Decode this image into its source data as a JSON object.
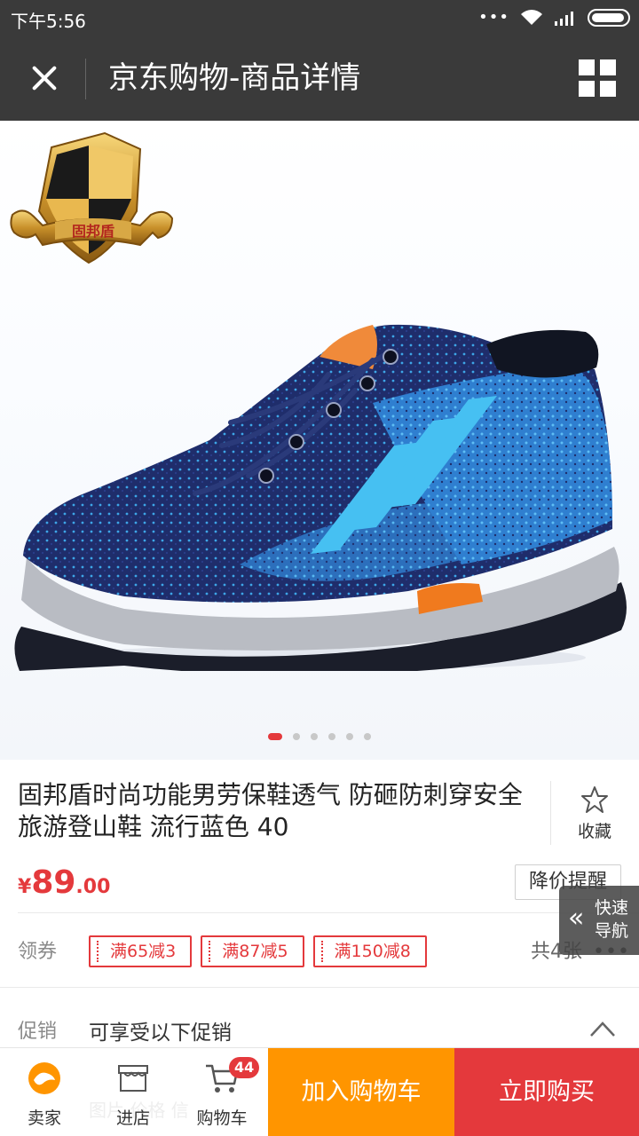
{
  "status_bar": {
    "time": "下午5:56",
    "icons": [
      "more-dots-icon",
      "wifi-icon",
      "signal-icon",
      "battery-icon"
    ]
  },
  "header": {
    "title": "京东购物-商品详情",
    "close_icon": "close-icon",
    "menu_icon": "grid-menu-icon"
  },
  "gallery": {
    "total_images": 6,
    "current_index": 1,
    "brand_logo_text": "固邦盾"
  },
  "product": {
    "name": "固邦盾时尚功能男劳保鞋透气 防砸防刺穿安全旅游登山鞋 流行蓝色 40",
    "favorite_label": "收藏",
    "price_currency": "¥",
    "price_integer": "89",
    "price_decimal": ".00",
    "price_reminder_label": "降价提醒"
  },
  "coupons": {
    "label": "领券",
    "items": [
      "满65减3",
      "满87减5",
      "满150减8"
    ],
    "total_text": "共4张",
    "more": "•••"
  },
  "promotion": {
    "label": "促销",
    "text": "可享受以下促销"
  },
  "quick_nav": {
    "label": "快速导航"
  },
  "bottom_bar": {
    "seller_label": "卖家",
    "store_label": "进店",
    "cart_label": "购物车",
    "cart_count": "44",
    "add_to_cart_label": "加入购物车",
    "buy_now_label": "立即购买",
    "faded_text": "图片 价格 信"
  },
  "colors": {
    "accent_red": "#e4393c",
    "accent_orange": "#ff9500",
    "header_bg": "#3a3a3a"
  }
}
